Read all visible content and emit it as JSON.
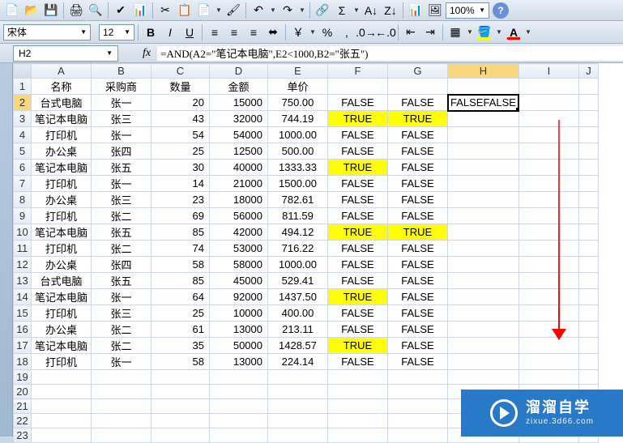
{
  "toolbar1": {
    "zoom": "100%"
  },
  "toolbar2": {
    "font_name": "宋体",
    "font_size": "12"
  },
  "formula_bar": {
    "name_box": "H2",
    "fx_label": "fx",
    "formula": "=AND(A2=\"笔记本电脑\",E2<1000,B2=\"张五\")"
  },
  "columns": [
    "A",
    "B",
    "C",
    "D",
    "E",
    "F",
    "G",
    "H",
    "I",
    "J"
  ],
  "headers": {
    "A": "名称",
    "B": "采购商",
    "C": "数量",
    "D": "金额",
    "E": "单价"
  },
  "rows": [
    {
      "r": 2,
      "A": "台式电脑",
      "B": "张一",
      "C": "20",
      "D": "15000",
      "E": "750.00",
      "F": "FALSE",
      "G": "FALSE",
      "H": "FALSE"
    },
    {
      "r": 3,
      "A": "笔记本电脑",
      "B": "张三",
      "C": "43",
      "D": "32000",
      "E": "744.19",
      "F": "TRUE",
      "Fhl": true,
      "G": "TRUE",
      "Ghl": true
    },
    {
      "r": 4,
      "A": "打印机",
      "B": "张一",
      "C": "54",
      "D": "54000",
      "E": "1000.00",
      "F": "FALSE",
      "G": "FALSE"
    },
    {
      "r": 5,
      "A": "办公桌",
      "B": "张四",
      "C": "25",
      "D": "12500",
      "E": "500.00",
      "F": "FALSE",
      "G": "FALSE"
    },
    {
      "r": 6,
      "A": "笔记本电脑",
      "B": "张五",
      "C": "30",
      "D": "40000",
      "E": "1333.33",
      "F": "TRUE",
      "Fhl": true,
      "G": "FALSE"
    },
    {
      "r": 7,
      "A": "打印机",
      "B": "张一",
      "C": "14",
      "D": "21000",
      "E": "1500.00",
      "F": "FALSE",
      "G": "FALSE"
    },
    {
      "r": 8,
      "A": "办公桌",
      "B": "张三",
      "C": "23",
      "D": "18000",
      "E": "782.61",
      "F": "FALSE",
      "G": "FALSE"
    },
    {
      "r": 9,
      "A": "打印机",
      "B": "张二",
      "C": "69",
      "D": "56000",
      "E": "811.59",
      "F": "FALSE",
      "G": "FALSE"
    },
    {
      "r": 10,
      "A": "笔记本电脑",
      "B": "张五",
      "C": "85",
      "D": "42000",
      "E": "494.12",
      "F": "TRUE",
      "Fhl": true,
      "G": "TRUE",
      "Ghl": true
    },
    {
      "r": 11,
      "A": "打印机",
      "B": "张二",
      "C": "74",
      "D": "53000",
      "E": "716.22",
      "F": "FALSE",
      "G": "FALSE"
    },
    {
      "r": 12,
      "A": "办公桌",
      "B": "张四",
      "C": "58",
      "D": "58000",
      "E": "1000.00",
      "F": "FALSE",
      "G": "FALSE"
    },
    {
      "r": 13,
      "A": "台式电脑",
      "B": "张五",
      "C": "85",
      "D": "45000",
      "E": "529.41",
      "F": "FALSE",
      "G": "FALSE"
    },
    {
      "r": 14,
      "A": "笔记本电脑",
      "B": "张一",
      "C": "64",
      "D": "92000",
      "E": "1437.50",
      "F": "TRUE",
      "Fhl": true,
      "G": "FALSE"
    },
    {
      "r": 15,
      "A": "打印机",
      "B": "张三",
      "C": "25",
      "D": "10000",
      "E": "400.00",
      "F": "FALSE",
      "G": "FALSE"
    },
    {
      "r": 16,
      "A": "办公桌",
      "B": "张二",
      "C": "61",
      "D": "13000",
      "E": "213.11",
      "F": "FALSE",
      "G": "FALSE"
    },
    {
      "r": 17,
      "A": "笔记本电脑",
      "B": "张二",
      "C": "35",
      "D": "50000",
      "E": "1428.57",
      "F": "TRUE",
      "Fhl": true,
      "G": "FALSE"
    },
    {
      "r": 18,
      "A": "打印机",
      "B": "张一",
      "C": "58",
      "D": "13000",
      "E": "224.14",
      "F": "FALSE",
      "G": "FALSE"
    }
  ],
  "empty_rows": [
    19,
    20,
    21,
    22,
    23
  ],
  "active_cell": "H2",
  "watermark": {
    "main": "溜溜自学",
    "sub": "zixue.3d66.com"
  }
}
